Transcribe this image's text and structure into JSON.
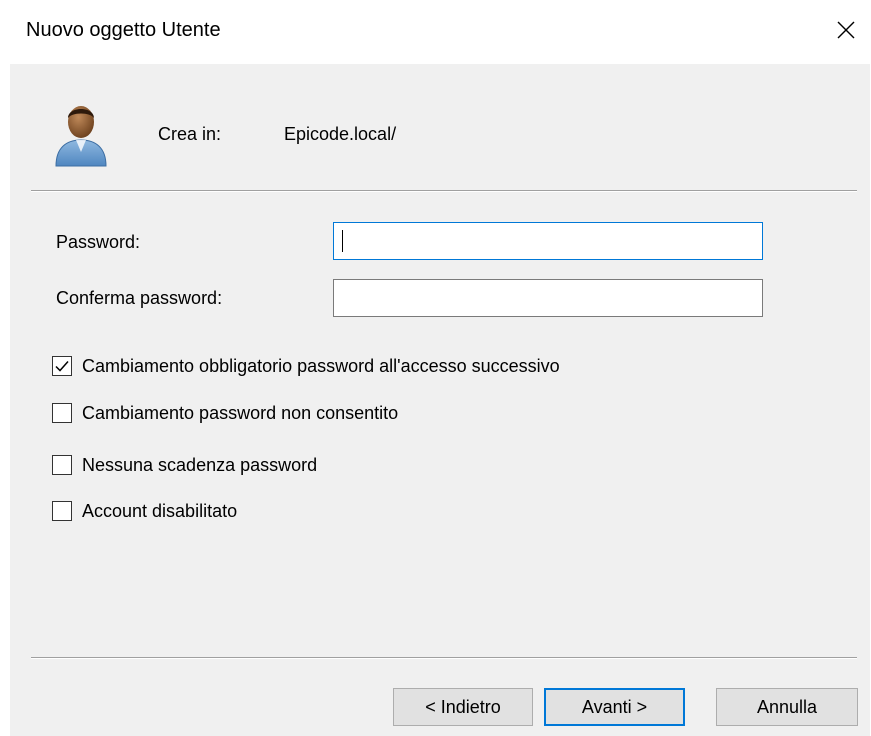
{
  "dialog": {
    "title": "Nuovo oggetto Utente",
    "close_icon": "close-icon"
  },
  "header": {
    "icon": "user-icon",
    "create_in_label": "Crea in:",
    "create_in_value": "Epicode.local/"
  },
  "form": {
    "password_label": "Password:",
    "password_value": "",
    "confirm_label": "Conferma password:",
    "confirm_value": ""
  },
  "options": [
    {
      "label": "Cambiamento obbligatorio password all'accesso successivo",
      "checked": true
    },
    {
      "label": "Cambiamento password non consentito",
      "checked": false
    },
    {
      "label": "Nessuna scadenza password",
      "checked": false
    },
    {
      "label": "Account disabilitato",
      "checked": false
    }
  ],
  "buttons": {
    "back": "< Indietro",
    "next": "Avanti >",
    "cancel": "Annulla"
  },
  "colors": {
    "accent": "#0078d7",
    "panel_bg": "#f0f0f0",
    "button_bg": "#e1e1e1"
  }
}
